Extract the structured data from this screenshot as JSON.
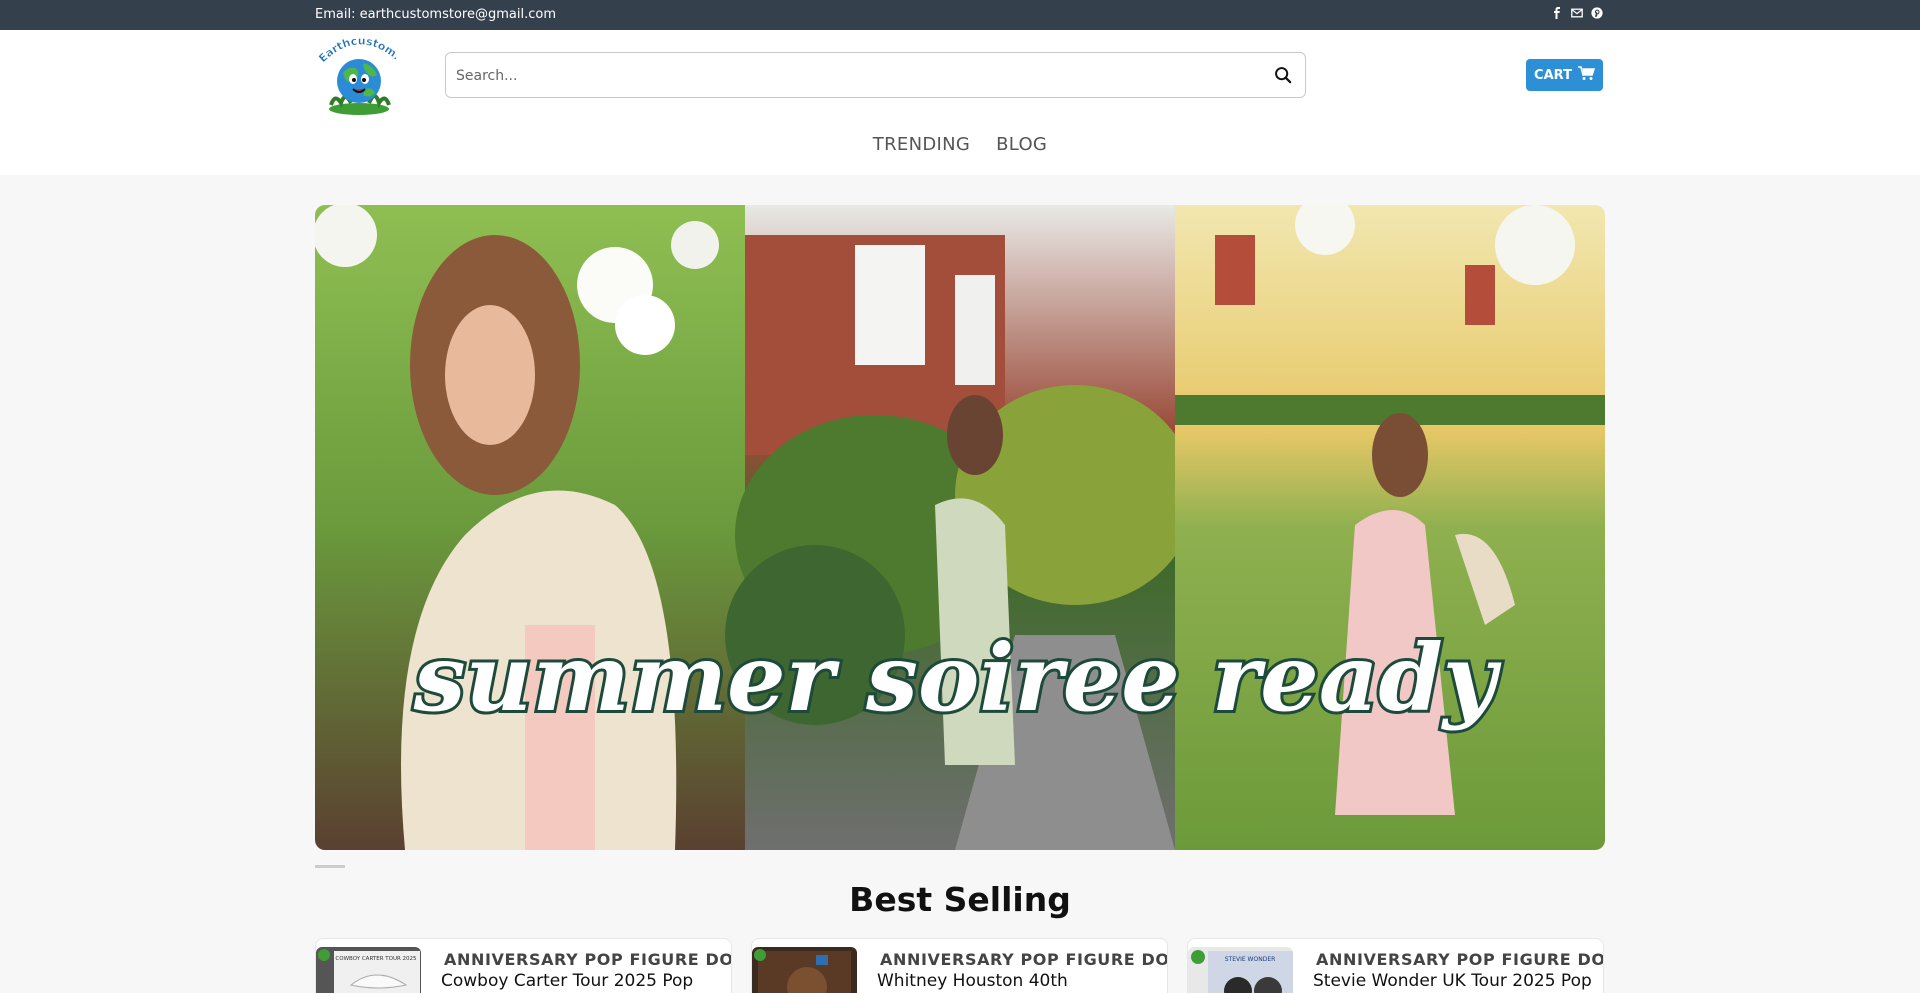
{
  "topbar": {
    "email": "Email: earthcustomstore@gmail.com",
    "social_icons": [
      "facebook-icon",
      "envelope-icon",
      "pinterest-icon"
    ]
  },
  "header": {
    "logo_text": "Earthcustom.com",
    "search": {
      "placeholder": "Search...",
      "value": ""
    },
    "cart_label": "CART"
  },
  "nav": {
    "items": [
      "TRENDING",
      "BLOG"
    ]
  },
  "hero": {
    "headline": "summer soiree ready"
  },
  "best_selling": {
    "title": "Best Selling",
    "products": [
      {
        "category": "ANNIVERSARY POP FIGURE DOLL",
        "name": "Cowboy Carter Tour 2025 Pop",
        "thumb_label": "COWBOY CARTER TOUR 2025"
      },
      {
        "category": "ANNIVERSARY POP FIGURE DOLL",
        "name": "Whitney Houston 40th",
        "thumb_label": ""
      },
      {
        "category": "ANNIVERSARY POP FIGURE DOLL",
        "name": "Stevie Wonder UK Tour 2025 Pop",
        "thumb_label": "STEVIE WONDER"
      }
    ]
  },
  "colors": {
    "topbar": "#35404d",
    "cart": "#2d8fd5",
    "background": "#f7f7f7"
  }
}
